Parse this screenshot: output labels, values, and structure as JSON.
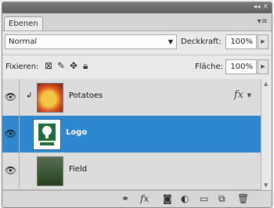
{
  "panel": {
    "title_controls": "◂◂ ✕",
    "tab_label": "Ebenen",
    "menu_icon": "panel-menu-icon"
  },
  "options": {
    "blend_mode": "Normal",
    "opacity_label": "Deckkraft:",
    "opacity_value": "100%",
    "lock_label": "Fixieren:",
    "fill_label": "Fläche:",
    "fill_value": "100%"
  },
  "layers": [
    {
      "name": "Potatoes",
      "visible": true,
      "selected": false,
      "clipped": true,
      "has_fx": true,
      "fx_label": "fx"
    },
    {
      "name": "Logo",
      "visible": true,
      "selected": true,
      "clipped": false,
      "has_fx": false
    },
    {
      "name": "Field",
      "visible": true,
      "selected": false,
      "clipped": false,
      "has_fx": false
    }
  ],
  "bottom_bar": {
    "icons": [
      "link-layers-icon",
      "layer-style-icon",
      "layer-mask-icon",
      "adjustment-layer-icon",
      "new-group-icon",
      "new-layer-icon",
      "delete-layer-icon"
    ],
    "fx_label": "fx"
  },
  "colors": {
    "selection": "#2f88cf",
    "panel_bg": "#e4e4e4"
  }
}
